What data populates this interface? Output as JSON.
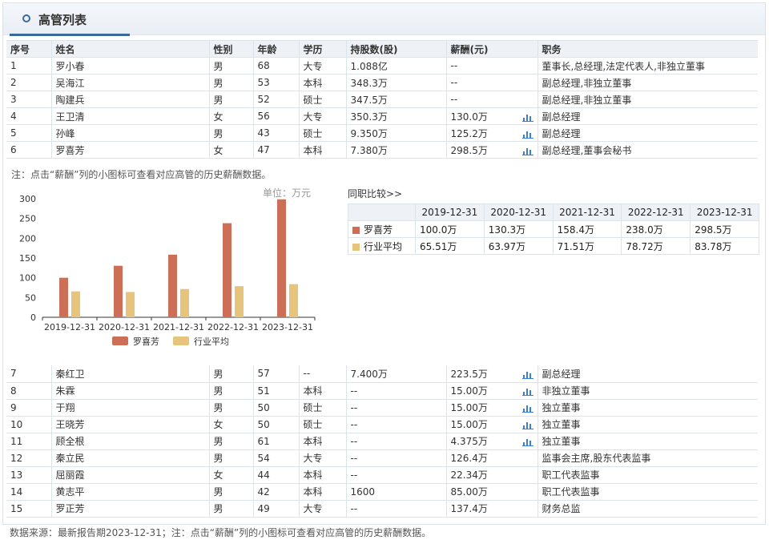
{
  "panel": {
    "title": "高管列表"
  },
  "table": {
    "headers": [
      "序号",
      "姓名",
      "性别",
      "年龄",
      "学历",
      "持股数(股)",
      "薪酬(元)",
      "职务"
    ],
    "rows_top": [
      {
        "no": "1",
        "name": "罗小春",
        "gender": "男",
        "age": "68",
        "edu": "大专",
        "shares": "1.088亿",
        "salary": "--",
        "icon": false,
        "title": "董事长,总经理,法定代表人,非独立董事"
      },
      {
        "no": "2",
        "name": "吴海江",
        "gender": "男",
        "age": "53",
        "edu": "本科",
        "shares": "348.3万",
        "salary": "--",
        "icon": false,
        "title": "副总经理,非独立董事"
      },
      {
        "no": "3",
        "name": "陶建兵",
        "gender": "男",
        "age": "52",
        "edu": "硕士",
        "shares": "347.5万",
        "salary": "--",
        "icon": false,
        "title": "副总经理,非独立董事"
      },
      {
        "no": "4",
        "name": "王卫清",
        "gender": "女",
        "age": "56",
        "edu": "大专",
        "shares": "350.3万",
        "salary": "130.0万",
        "icon": true,
        "title": "副总经理"
      },
      {
        "no": "5",
        "name": "孙峰",
        "gender": "男",
        "age": "43",
        "edu": "硕士",
        "shares": "9.350万",
        "salary": "125.2万",
        "icon": true,
        "title": "副总经理"
      },
      {
        "no": "6",
        "name": "罗喜芳",
        "gender": "女",
        "age": "47",
        "edu": "本科",
        "shares": "7.380万",
        "salary": "298.5万",
        "icon": true,
        "title": "副总经理,董事会秘书"
      }
    ],
    "rows_bottom": [
      {
        "no": "7",
        "name": "秦红卫",
        "gender": "男",
        "age": "57",
        "edu": "--",
        "shares": "7.400万",
        "salary": "223.5万",
        "icon": true,
        "title": "副总经理"
      },
      {
        "no": "8",
        "name": "朱霖",
        "gender": "男",
        "age": "51",
        "edu": "本科",
        "shares": "--",
        "salary": "15.00万",
        "icon": true,
        "title": "非独立董事"
      },
      {
        "no": "9",
        "name": "于翔",
        "gender": "男",
        "age": "50",
        "edu": "硕士",
        "shares": "--",
        "salary": "15.00万",
        "icon": true,
        "title": "独立董事"
      },
      {
        "no": "10",
        "name": "王晓芳",
        "gender": "女",
        "age": "50",
        "edu": "硕士",
        "shares": "--",
        "salary": "15.00万",
        "icon": true,
        "title": "独立董事"
      },
      {
        "no": "11",
        "name": "顾全根",
        "gender": "男",
        "age": "61",
        "edu": "本科",
        "shares": "--",
        "salary": "4.375万",
        "icon": true,
        "title": "独立董事"
      },
      {
        "no": "12",
        "name": "秦立民",
        "gender": "男",
        "age": "54",
        "edu": "大专",
        "shares": "--",
        "salary": "126.4万",
        "icon": false,
        "title": "监事会主席,股东代表监事"
      },
      {
        "no": "13",
        "name": "屈丽霞",
        "gender": "女",
        "age": "44",
        "edu": "本科",
        "shares": "--",
        "salary": "22.34万",
        "icon": false,
        "title": "职工代表监事"
      },
      {
        "no": "14",
        "name": "黄志平",
        "gender": "男",
        "age": "42",
        "edu": "本科",
        "shares": "1600",
        "salary": "85.00万",
        "icon": false,
        "title": "职工代表监事"
      },
      {
        "no": "15",
        "name": "罗正芳",
        "gender": "男",
        "age": "49",
        "edu": "大专",
        "shares": "--",
        "salary": "137.4万",
        "icon": false,
        "title": "财务总监"
      }
    ]
  },
  "note": "注：点击“薪酬”列的小图标可查看对应高管的历史薪酬数据。",
  "chart_unit": "单位：万元",
  "chart_data": {
    "type": "bar",
    "categories": [
      "2019-12-31",
      "2020-12-31",
      "2021-12-31",
      "2022-12-31",
      "2023-12-31"
    ],
    "series": [
      {
        "name": "罗喜芳",
        "values": [
          100.0,
          130.3,
          158.4,
          238.0,
          298.5
        ],
        "color": "#cd6f56"
      },
      {
        "name": "行业平均",
        "values": [
          65.51,
          63.97,
          71.51,
          78.72,
          83.78
        ],
        "color": "#e6c47c"
      }
    ],
    "yticks": [
      0,
      50,
      100,
      150,
      200,
      250,
      300
    ],
    "ylim": [
      0,
      300
    ],
    "legend": "bottom"
  },
  "compare": {
    "title": "同职比较>>",
    "dates": [
      "2019-12-31",
      "2020-12-31",
      "2021-12-31",
      "2022-12-31",
      "2023-12-31"
    ],
    "rows": [
      {
        "label": "罗喜芳",
        "color": "#cd6f56",
        "values": [
          "100.0万",
          "130.3万",
          "158.4万",
          "238.0万",
          "298.5万"
        ]
      },
      {
        "label": "行业平均",
        "color": "#e6c47c",
        "values": [
          "65.51万",
          "63.97万",
          "71.51万",
          "78.72万",
          "83.78万"
        ]
      }
    ]
  },
  "footer": "数据来源：最新报告期2023-12-31；注：点击“薪酬”列的小图标可查看对应高管的历史薪酬数据。"
}
